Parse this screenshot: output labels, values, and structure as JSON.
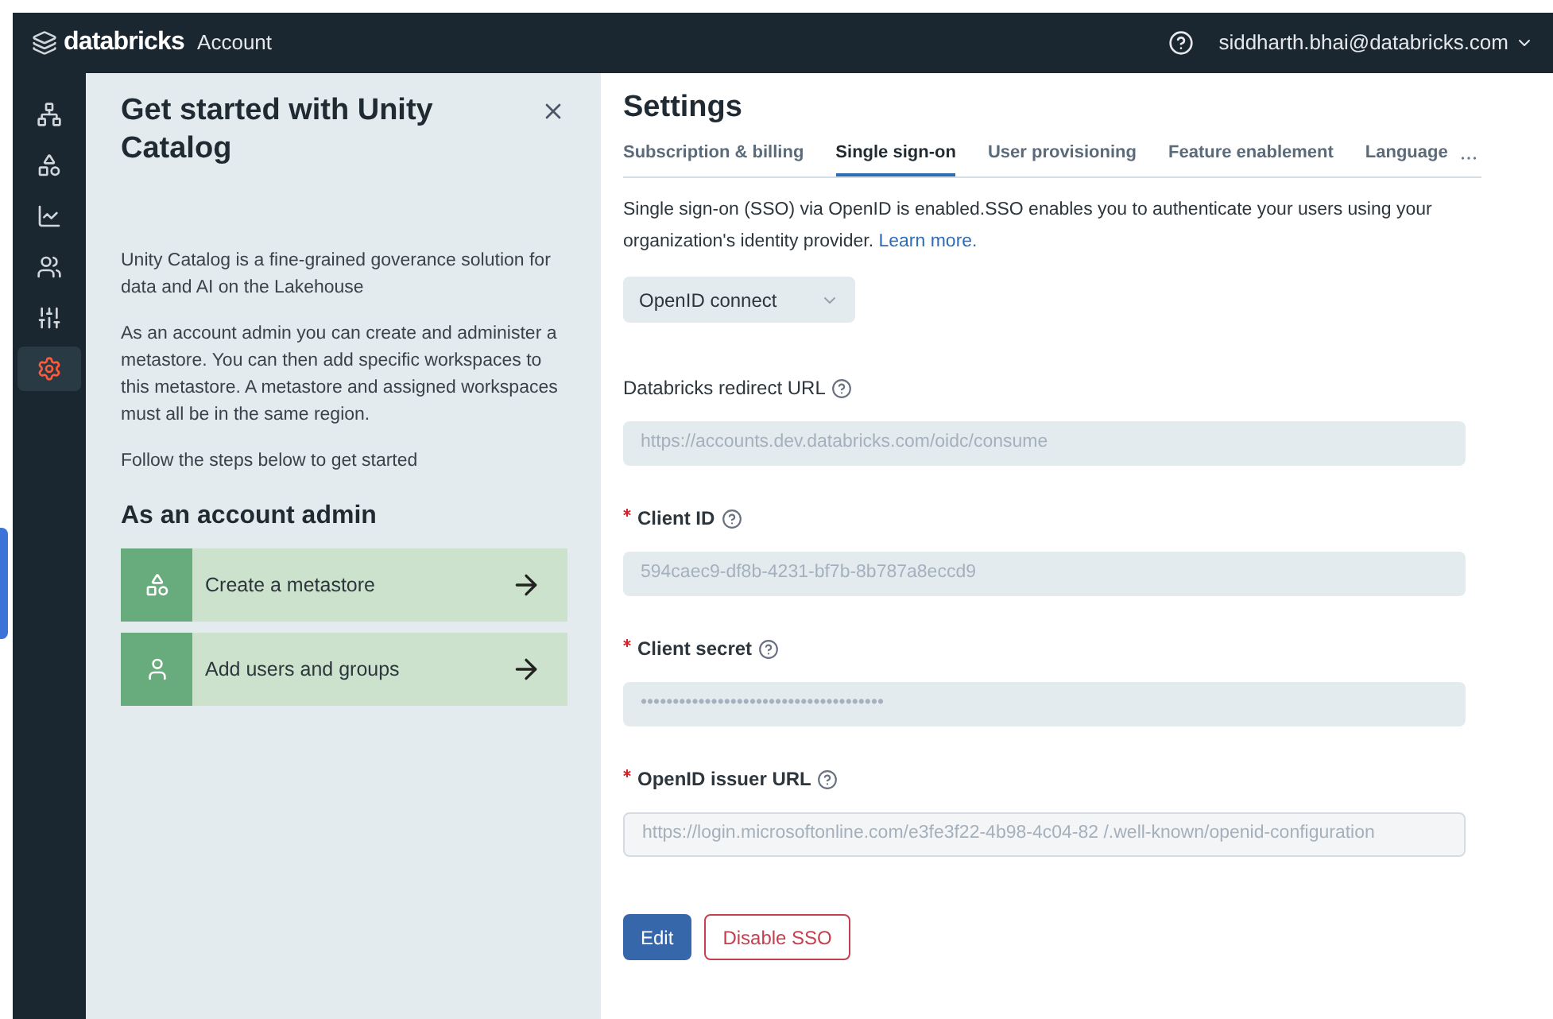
{
  "header": {
    "brand": "databricks",
    "product": "Account",
    "user": "siddharth.bhai@databricks.com"
  },
  "sidebar": {
    "items": [
      {
        "kind": "catalog",
        "selected": false
      },
      {
        "kind": "shapes",
        "selected": false
      },
      {
        "kind": "chart",
        "selected": false
      },
      {
        "kind": "users",
        "selected": false
      },
      {
        "kind": "sliders",
        "selected": false
      },
      {
        "kind": "settings",
        "selected": true
      }
    ]
  },
  "guide": {
    "title": "Get started with Unity Catalog",
    "paragraphs": [
      "Unity Catalog is a fine-grained goverance solution for data and AI on the Lakehouse",
      "As an account admin you can create and administer a metastore. You can then add specific workspaces to this metastore. A metastore and assigned workspaces must all be in the same region.",
      "Follow the steps below to get started"
    ],
    "subtitle": "As an account admin",
    "steps": [
      {
        "kind": "shapes",
        "label": "Create a metastore"
      },
      {
        "kind": "user",
        "label": "Add users and groups"
      }
    ]
  },
  "settings": {
    "title": "Settings",
    "tabs": [
      {
        "label": "Subscription & billing",
        "selected": false
      },
      {
        "label": "Single sign-on",
        "selected": true
      },
      {
        "label": "User provisioning",
        "selected": false
      },
      {
        "label": "Feature enablement",
        "selected": false
      },
      {
        "label": "Language",
        "selected": false
      }
    ],
    "description": "Single sign-on (SSO) via OpenID is enabled.SSO enables you to authenticate your users using your organization's identity provider.",
    "learn_more": "Learn more.",
    "protocol": "OpenID connect",
    "fields": [
      {
        "label": "Databricks redirect URL",
        "required": false,
        "value": "https://accounts.dev.databricks.com/oidc/consume",
        "bordered": false
      },
      {
        "label": "Client ID",
        "required": true,
        "value": "594caec9-df8b-4231-bf7b-8b787a8eccd9",
        "bordered": false
      },
      {
        "label": "Client secret",
        "required": true,
        "value": "••••••••••••••••••••••••••••••••••••••",
        "bordered": false
      },
      {
        "label": "OpenID issuer URL",
        "required": true,
        "value": "https://login.microsoftonline.com/e3fe3f22-4b98-4c04-82  /.well-known/openid-configuration",
        "bordered": true
      }
    ],
    "buttons": {
      "edit": "Edit",
      "disable": "Disable SSO"
    }
  }
}
